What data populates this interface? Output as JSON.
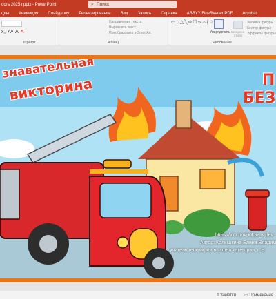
{
  "titlebar": {
    "document": "ость 2025 г.pptx  -  PowerPoint"
  },
  "search": {
    "placeholder": "Поиск"
  },
  "tabs": [
    "оды",
    "Анимация",
    "Слайд-шоу",
    "Рецензирование",
    "Вид",
    "Запись",
    "Справка",
    "ABBYY FineReader PDF",
    "Acrobat"
  ],
  "ribbon": {
    "groups": [
      {
        "label": "Шрифт"
      },
      {
        "label": "Абзац"
      },
      {
        "label": "Рисование"
      }
    ],
    "para_items": [
      "Направление текста",
      "Выровнять текст",
      "Преобразовать в SmartArt"
    ],
    "arrange_label": "Упорядочить",
    "styles_label": "Экспресс-стили",
    "fill_items": [
      "Заливка фигуры",
      "Контур фигуры",
      "Эффекты фигуры"
    ]
  },
  "slide": {
    "title_line1": "знавательная",
    "title_line2": "викторина",
    "right_line1": "П",
    "right_line2": "БЕЗО",
    "url": "https://vk.com/pokaz_vjdev",
    "author": "Автор:  Колышкина Елена Владим",
    "job": "учитель географии высшей категории, г. Н"
  },
  "status": {
    "notes": "Заметки",
    "comments": "Примечания"
  },
  "colors": {
    "accent": "#c23b22",
    "slide_border": "#e8771c"
  }
}
